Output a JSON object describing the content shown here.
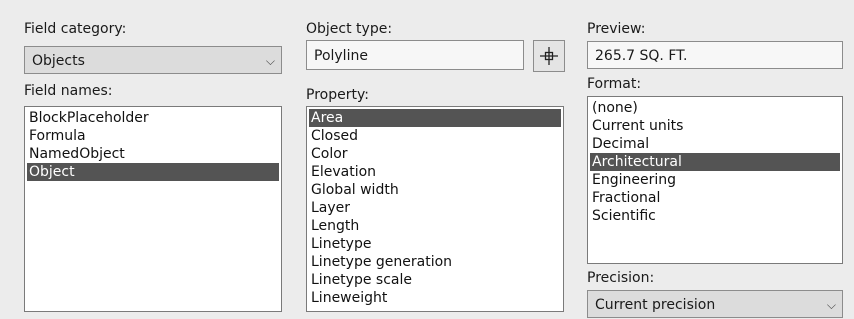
{
  "field_category": {
    "label": "Field category:",
    "value": "Objects",
    "arrow": "⌵"
  },
  "field_names": {
    "label": "Field names:",
    "items": [
      "BlockPlaceholder",
      "Formula",
      "NamedObject",
      "Object"
    ],
    "selected_index": 3
  },
  "object_type": {
    "label": "Object type:",
    "value": "Polyline",
    "pick_icon": "crosshair-icon"
  },
  "property": {
    "label": "Property:",
    "items": [
      "Area",
      "Closed",
      "Color",
      "Elevation",
      "Global width",
      "Layer",
      "Length",
      "Linetype",
      "Linetype generation",
      "Linetype scale",
      "Lineweight"
    ],
    "selected_index": 0
  },
  "preview": {
    "label": "Preview:",
    "value": "265.7 SQ. FT."
  },
  "format": {
    "label": "Format:",
    "items": [
      "(none)",
      "Current units",
      "Decimal",
      "Architectural",
      "Engineering",
      "Fractional",
      "Scientific"
    ],
    "selected_index": 3
  },
  "precision": {
    "label": "Precision:",
    "value": "Current precision",
    "arrow": "⌵"
  },
  "colors": {
    "selection": "#545454",
    "background": "#ececec"
  }
}
